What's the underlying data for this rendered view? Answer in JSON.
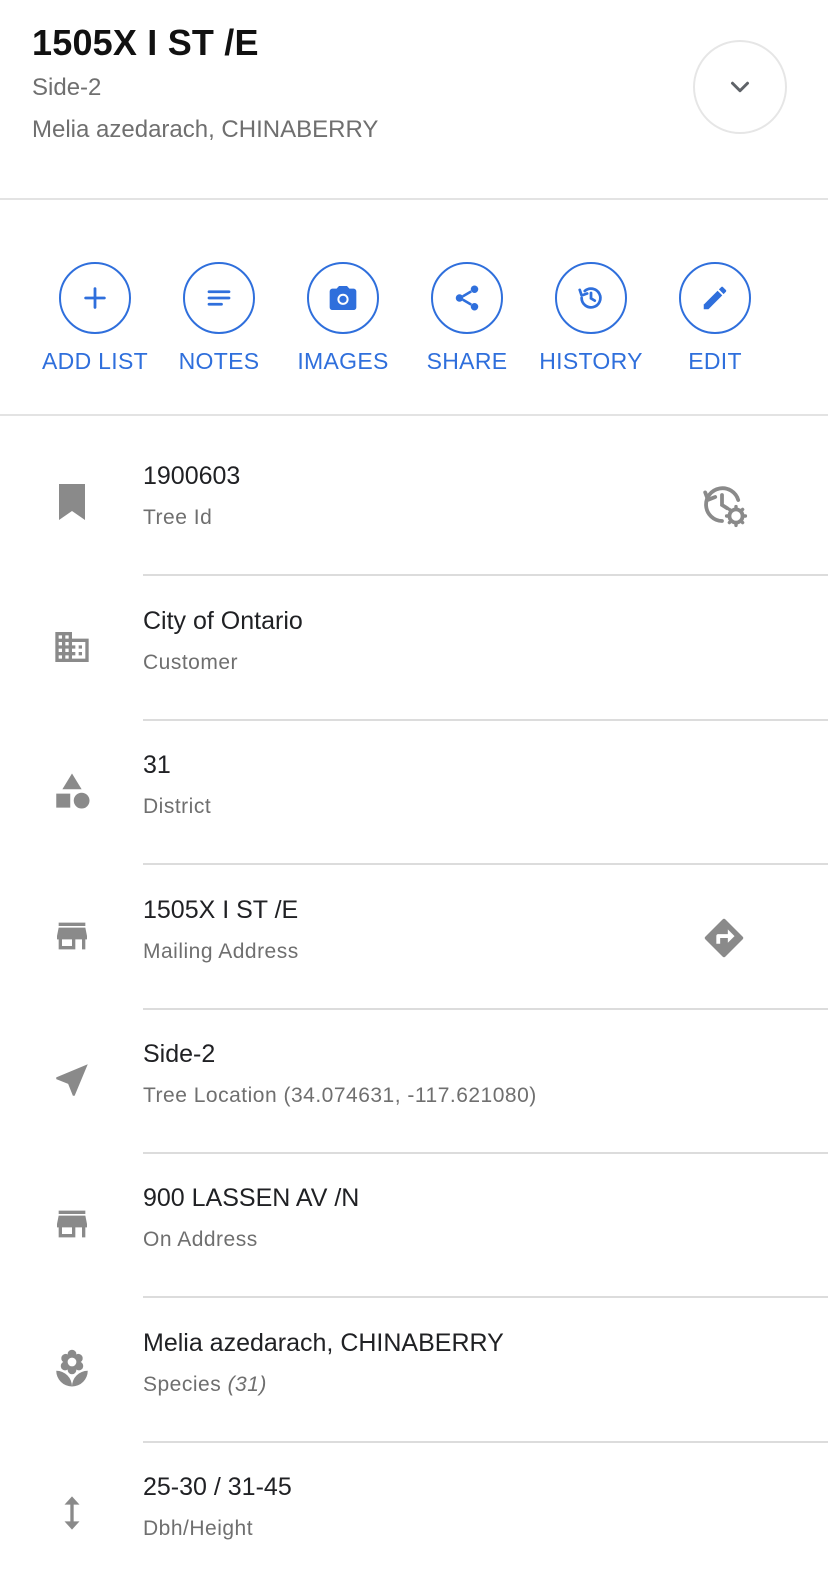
{
  "header": {
    "title": "1505X I ST /E",
    "subtitle": "Side-2",
    "species_line": "Melia azedarach, CHINABERRY"
  },
  "actions": [
    {
      "label": "ADD LIST",
      "icon": "plus-icon"
    },
    {
      "label": "NOTES",
      "icon": "notes-icon"
    },
    {
      "label": "IMAGES",
      "icon": "camera-icon"
    },
    {
      "label": "SHARE",
      "icon": "share-icon"
    },
    {
      "label": "HISTORY",
      "icon": "history-icon"
    },
    {
      "label": "EDIT",
      "icon": "pencil-icon"
    }
  ],
  "details": [
    {
      "value": "1900603",
      "label": "Tree Id",
      "icon": "bookmark-icon",
      "action_icon": "history-settings-icon"
    },
    {
      "value": "City of Ontario",
      "label": "Customer",
      "icon": "building-icon"
    },
    {
      "value": "31",
      "label": "District",
      "icon": "shapes-icon"
    },
    {
      "value": "1505X I ST /E",
      "label": "Mailing Address",
      "icon": "storefront-icon",
      "action_icon": "directions-icon"
    },
    {
      "value": "Side-2",
      "label": "Tree Location (34.074631, -117.621080)",
      "icon": "navigation-icon"
    },
    {
      "value": "900 LASSEN AV /N",
      "label": "On Address",
      "icon": "storefront-icon"
    },
    {
      "value": "Melia azedarach, CHINABERRY",
      "label": "Species",
      "label_suffix": "(31)",
      "icon": "flower-icon"
    },
    {
      "value": "25-30 / 31-45",
      "label": "Dbh/Height",
      "icon": "vertical-arrows-icon"
    }
  ],
  "colors": {
    "accent": "#2f6fdc",
    "icon_gray": "#8a8a8a",
    "secondary_text": "#6f6f6f",
    "divider": "#dcdcdc"
  }
}
